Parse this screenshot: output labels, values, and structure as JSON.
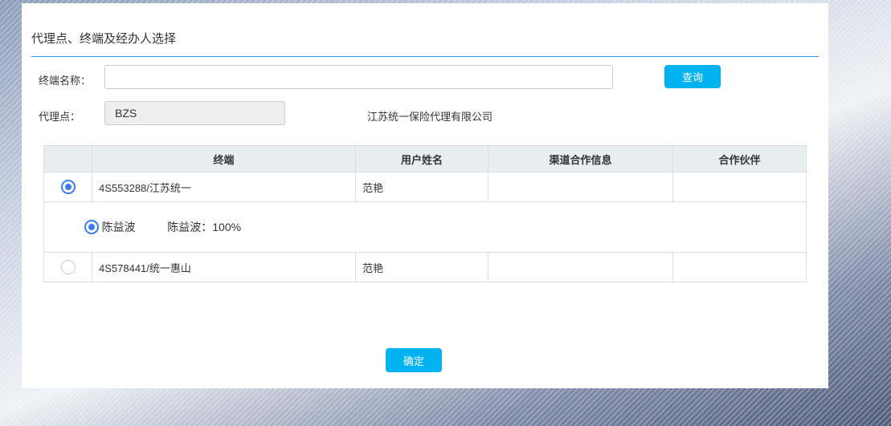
{
  "dialog": {
    "title": "代理点、终端及经办人选择"
  },
  "form": {
    "terminal_label": "终端名称：",
    "terminal_value": "",
    "query_label": "查询",
    "agent_label": "代理点：",
    "agent_value": "BZS",
    "agent_company": "江苏统一保险代理有限公司"
  },
  "table": {
    "headers": [
      "",
      "终端",
      "用户姓名",
      "渠道合作信息",
      "合作伙伴"
    ],
    "rows": [
      {
        "selected": true,
        "terminal": "4S553288/江苏统一",
        "user": "范艳",
        "channel": "",
        "partner": ""
      },
      {
        "selected": false,
        "terminal": "4S578441/统一惠山",
        "user": "范艳",
        "channel": "",
        "partner": ""
      }
    ],
    "handler": {
      "selected": true,
      "name": "陈益波",
      "share": "陈益波：100%"
    }
  },
  "footer": {
    "confirm_label": "确定"
  },
  "colors": {
    "accent": "#00b2f0",
    "radio": "#3a7cf0"
  }
}
